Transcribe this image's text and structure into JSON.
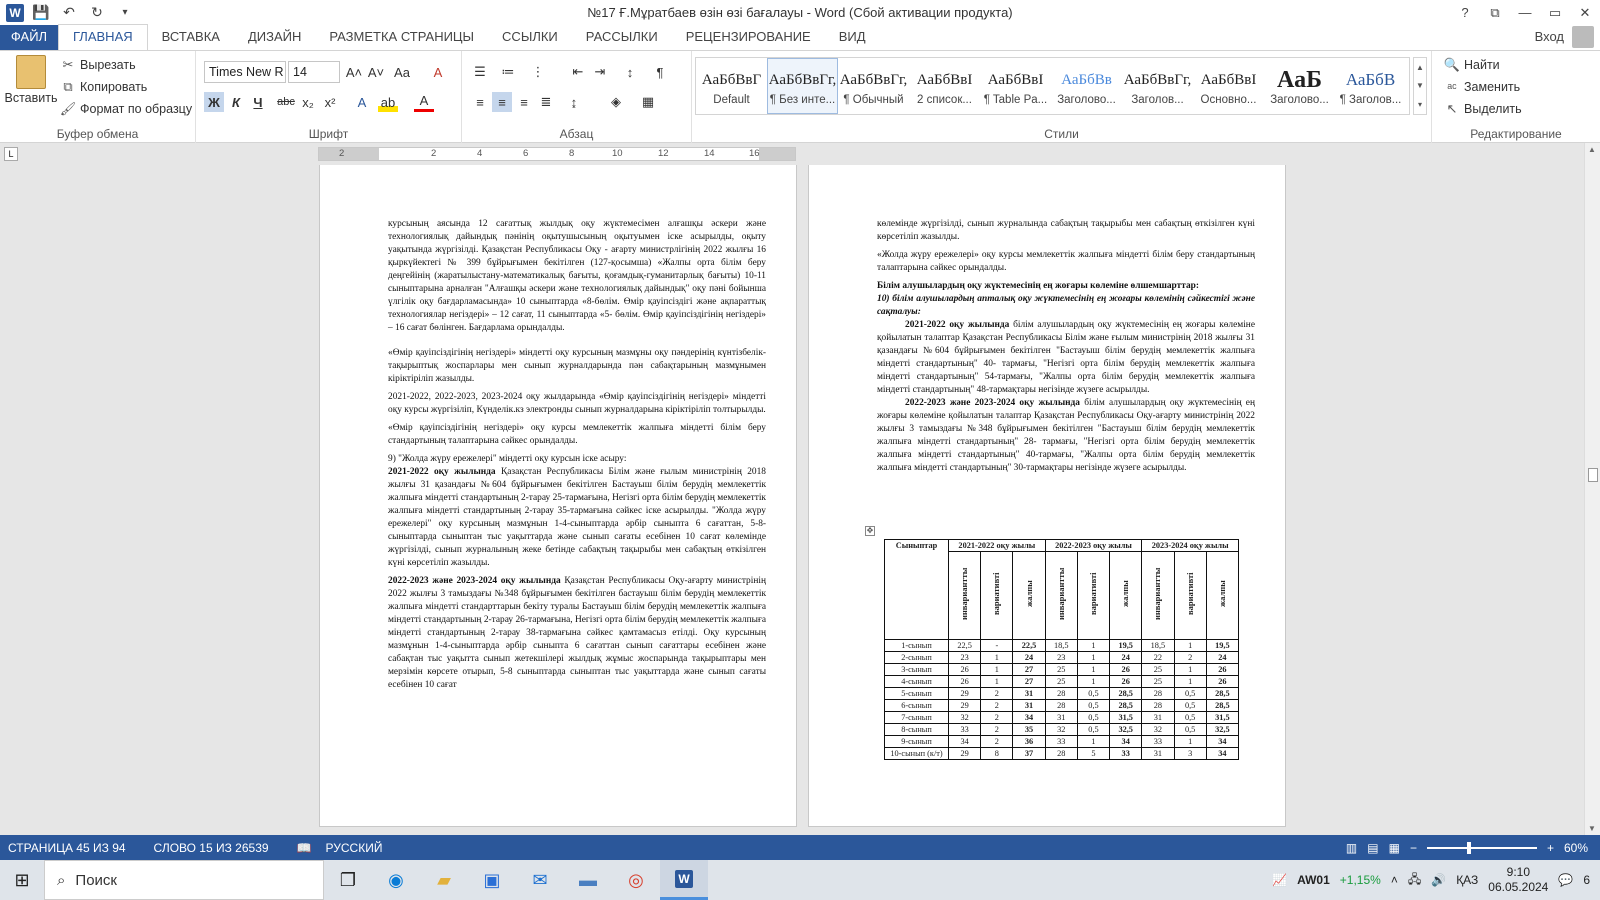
{
  "window": {
    "title": "№17 Ғ.Мұратбаев өзін өзі бағалауы - Word (Сбой активации продукта)",
    "help": "?",
    "minimize": "—",
    "restore": "▭",
    "close": "✕"
  },
  "quick_access": {
    "save_icon": "save-icon",
    "undo_icon": "undo-icon",
    "redo_icon": "redo-icon"
  },
  "tabs": [
    {
      "label": "ФАЙЛ"
    },
    {
      "label": "ГЛАВНАЯ"
    },
    {
      "label": "ВСТАВКА"
    },
    {
      "label": "ДИЗАЙН"
    },
    {
      "label": "РАЗМЕТКА СТРАНИЦЫ"
    },
    {
      "label": "ССЫЛКИ"
    },
    {
      "label": "РАССЫЛКИ"
    },
    {
      "label": "РЕЦЕНЗИРОВАНИЕ"
    },
    {
      "label": "ВИД"
    }
  ],
  "login_label": "Вход",
  "ribbon": {
    "clipboard": {
      "paste": "Вставить",
      "cut": "Вырезать",
      "copy": "Копировать",
      "format_painter": "Формат по образцу",
      "label": "Буфер обмена"
    },
    "font": {
      "name": "Times New R",
      "size": "14",
      "label": "Шрифт",
      "bold": "Ж",
      "italic": "К",
      "underline": "Ч",
      "strike": "abc",
      "sub": "x₂",
      "sup": "x²",
      "grow": "A^",
      "shrink": "A˅",
      "case": "Aa",
      "clear": "A"
    },
    "paragraph": {
      "label": "Абзац",
      "pilcrow": "¶"
    },
    "styles": {
      "label": "Стили",
      "items": [
        {
          "preview": "АаБбВвГ",
          "name": "Default"
        },
        {
          "preview": "АаБбВвГг,",
          "name": "¶ Без инте..."
        },
        {
          "preview": "АаБбВвГг,",
          "name": "¶ Обычный"
        },
        {
          "preview": "АаБбВвI",
          "name": "2 список..."
        },
        {
          "preview": "АаБбВвI",
          "name": "¶ Table Pa..."
        },
        {
          "preview": "АаБбВв",
          "name": "Заголово..."
        },
        {
          "preview": "АаБбВвГг,",
          "name": "Заголов..."
        },
        {
          "preview": "АаБбВвI",
          "name": "Основно..."
        },
        {
          "preview": "АаБ",
          "name": "Заголово..."
        },
        {
          "preview": "АаБбВ",
          "name": "¶ Заголов..."
        }
      ]
    },
    "editing": {
      "label": "Редактирование",
      "find": "Найти",
      "replace": "Заменить",
      "select": "Выделить"
    }
  },
  "ruler": {
    "marks": [
      "2",
      "2",
      "4",
      "6",
      "8",
      "10",
      "12",
      "14",
      "16"
    ]
  },
  "page1": {
    "paragraphs": [
      "курсының аясында 12 сағаттық жылдық оқу жүктемесімен алғашқы әскери және технологиялық дайындық пәнінің оқытушысының оқытуымен іске асырылды, оқыту уақытында жүргізілді. Қазақстан Республикасы Оқу - ағарту министрлігінің 2022 жылғы 16 қыркүйектегі № 399 бұйрығымен бекітілген (127-қосымша)   «Жалпы орта білім беру деңгейінің (жаратылыстану-математикалық бағыты, қоғамдық-гуманитарлық бағыты) 10-11 сыныптарына арналған \"Алғашқы әскери және технологиялық дайындық\" оқу пәні бойынша үлгілік оқу бағдарламасында» 10 сыныптарда «8-бөлім. Өмір қауіпсіздігі және ақпараттық технологиялар негіздері» – 12 сағат, 11 сыныптарда «5- бөлім. Өмір қауіпсіздігінің негіздері» – 16 сағат бөлінген. Бағдарлама орындалды.",
      "«Өмір қауіпсіздігінің негіздері» міндетті оқу курсының мазмұны оқу пәндерінің күнтізбелік-тақырыптық жоспарлары мен сынып журналдарында пән сабақтарының мазмұнымен кіріктіріліп жазылды.",
      "2021-2022, 2022-2023, 2023-2024 оқу жылдарында «Өмір қауіпсіздігінің негіздері» міндетті оқу курсы жүргізіліп, Күнделік.кз электронды сынып журналдарына кіріктіріліп толтырылды.",
      "«Өмір қауіпсіздігінің негіздері» оқу курсы мемлекеттік жалпыға міндетті білім беру стандартының талаптарына сәйкес орындалды.",
      "9) \"Жолда жүру ережелері\" міндетті оқу курсын іске асыру:"
    ],
    "p6_bold": "2021-2022 оқу жылында",
    "p6_rest": " Қазақстан Республикасы Білім және ғылым министрінің 2018 жылғы 31 қазандағы №604 бұйрығымен бекітілген Бастауыш білім берудің мемлекеттік жалпыға міндетті стандартының 2-тарау 25-тармағына, Негізгі орта білім берудің мемлекеттік жалпыға міндетті стандартының 2-тарау 35-тармағына сәйкес іске асырылды. \"Жолда жүру ережелері\" оқу курсының мазмұнын 1-4-сыныптарда әрбір сыныпта 6 сағаттан, 5-8-сыныптарда сыныптан тыс уақыттарда және сынып сағаты есебінен 10 сағат көлемінде жүргізілді, сынып журналының жеке бетінде сабақтың тақырыбы мен сабақтың өткізілген күні көрсетіліп жазылды.",
    "p7_bold": "2022-2023 және 2023-2024  оқу жылында",
    "p7_rest": " Қазақстан Республикасы Оқу-ағарту министрінің 2022 жылғы 3 тамыздағы №348 бұйрығымен бекітілген бастауыш білім берудің мемлекеттік жалпыға міндетті стандарттарын бекіту туралы Бастауыш білім берудің мемлекеттік жалпыға міндетті стандартының 2-тарау 26-тармағына, Негізгі орта білім берудің мемлекеттік жалпыға міндетті стандартының 2-тарау 38-тармағына сәйкес қамтамасыз етілді. Оқу курсының мазмұнын 1-4-сыныптарда әрбір сыныпта 6 сағаттан сынып сағаттары есебінен және сабақтан тыс уақытта сынып жетекшілері жылдық жұмыс жоспарында тақырыптары мен мерзімін көрсете отырып, 5-8 сыныптарда сыныптан тыс уақыттарда және сынып сағаты есебінен 10 сағат"
  },
  "page2": {
    "p1": "көлемінде жүргізілді, сынып журналында сабақтың тақырыбы мен сабақтың өткізілген күні көрсетіліп жазылды.",
    "p2": "«Жолда жүру ережелері» оқу курсы мемлекеттік жалпыға міндетті білім беру стандартының талаптарына сәйкес орындалды.",
    "h1": "Білім алушылардың оқу жүктемесінің ең жоғары көлеміне өлшемшарттар:",
    "h2": "10) білім алушылардың апталық оқу жүктемесінің ең жоғары көлемінің сәйкестігі және сақталуы:",
    "p3_bold": "2021-2022 оқу жылында",
    "p3_rest": " білім алушылардың оқу жүктемесінің ең жоғары көлеміне қойылатын талаптар Қазақстан Республикасы Білім және ғылым министрінің  2018 жылғы 31 қазандағы №604 бұйрығымен бекітілген \"Бастауыш білім берудің  мемлекеттік жалпыға міндетті стандартының\" 40- тармағы, \"Негізгі орта білім берудің мемлекеттік жалпыға міндетті стандартының\" 54-тармағы, \"Жалпы орта білім берудің мемлекеттік жалпыға міндетті  стандартының\" 48-тармақтары негізінде жүзеге асырылды.",
    "p4_bold": "2022-2023 және 2023-2024 оқу жылында",
    "p4_rest": " білім алушылардың оқу жүктемесінің ең жоғары көлеміне қойылатын талаптар Қазақстан Республикасы Оқу-ағарту министрінің 2022 жылғы 3 тамыздағы №348 бұйрығымен бекітілген \"Бастауыш білім берудің  мемлекеттік жалпыға міндетті стандартының\" 28- тармағы, \"Негізгі орта білім берудің мемлекеттік жалпыға міндетті  стандартының\" 40-тармағы,  \"Жалпы орта білім берудің мемлекеттік жалпыға міндетті  стандартының\" 30-тармақтары негізінде жүзеге асырылды.",
    "table": {
      "col0": "Сыныптар",
      "years": [
        "2021-2022 оқу жылы",
        "2022-2023 оқу жылы",
        "2023-2024 оқу жылы"
      ],
      "sub": [
        "инвариантты",
        "вариативті",
        "жалпы"
      ],
      "rows": [
        [
          "1-сынып",
          "22,5",
          "-",
          "22,5",
          "18,5",
          "1",
          "19,5",
          "18,5",
          "1",
          "19,5"
        ],
        [
          "2-сынып",
          "23",
          "1",
          "24",
          "23",
          "1",
          "24",
          "22",
          "2",
          "24"
        ],
        [
          "3-сынып",
          "26",
          "1",
          "27",
          "25",
          "1",
          "26",
          "25",
          "1",
          "26"
        ],
        [
          "4-сынып",
          "26",
          "1",
          "27",
          "25",
          "1",
          "26",
          "25",
          "1",
          "26"
        ],
        [
          "5-сынып",
          "29",
          "2",
          "31",
          "28",
          "0,5",
          "28,5",
          "28",
          "0,5",
          "28,5"
        ],
        [
          "6-сынып",
          "29",
          "2",
          "31",
          "28",
          "0,5",
          "28,5",
          "28",
          "0,5",
          "28,5"
        ],
        [
          "7-сынып",
          "32",
          "2",
          "34",
          "31",
          "0,5",
          "31,5",
          "31",
          "0,5",
          "31,5"
        ],
        [
          "8-сынып",
          "33",
          "2",
          "35",
          "32",
          "0,5",
          "32,5",
          "32",
          "0,5",
          "32,5"
        ],
        [
          "9-сынып",
          "34",
          "2",
          "36",
          "33",
          "1",
          "34",
          "33",
          "1",
          "34"
        ],
        [
          "10-сынып (к/т)",
          "29",
          "8",
          "37",
          "28",
          "5",
          "33",
          "31",
          "3",
          "34"
        ]
      ]
    }
  },
  "status": {
    "page": "СТРАНИЦА 45 ИЗ 94",
    "words": "СЛОВО 15 ИЗ 26539",
    "lang": "РУССКИЙ",
    "zoom": "60%"
  },
  "taskbar": {
    "search_placeholder": "Поиск",
    "account": "AW01",
    "change": "+1,15%",
    "lang": "ҚАЗ",
    "time": "9:10",
    "date": "06.05.2024",
    "notif": "6"
  }
}
